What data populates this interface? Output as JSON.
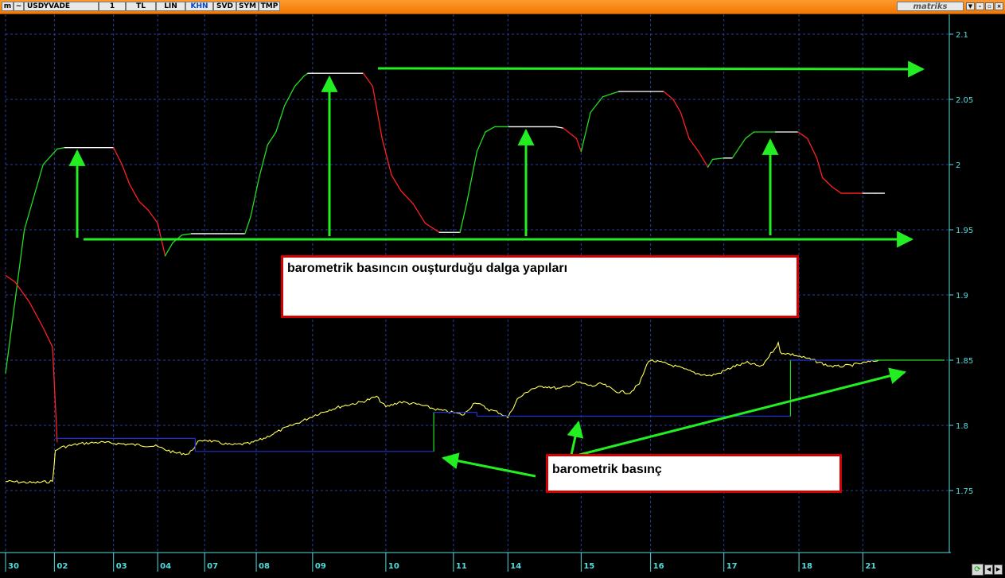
{
  "toolbar": {
    "symbol": "USDYVADE",
    "buttons": [
      {
        "label": "1",
        "active": false
      },
      {
        "label": "TL",
        "active": false
      },
      {
        "label": "LIN",
        "active": false
      },
      {
        "label": "KHN",
        "active": true
      },
      {
        "label": "SVD",
        "active": false
      },
      {
        "label": "SYM",
        "active": false
      },
      {
        "label": "TMP",
        "active": false
      }
    ],
    "brand": "matriks",
    "window_controls": [
      "▼",
      "–",
      "▫",
      "×"
    ]
  },
  "annotations": {
    "wave_text": "barometrik basıncın ouşturduğu dalga yapıları",
    "pressure_text": "barometrik basınç"
  },
  "chart_data": {
    "type": "line",
    "y_axis": {
      "min": 1.7,
      "max": 2.12,
      "ticks": [
        1.75,
        1.8,
        1.85,
        1.9,
        1.95,
        2.0,
        2.05,
        2.1
      ],
      "tick_labels": [
        "1.75",
        "1.8",
        "1.85",
        "1.9",
        "1.95",
        "2",
        "2.05",
        "2.1"
      ],
      "side": "right"
    },
    "x_axis": {
      "min": 0,
      "max": 100,
      "ticks": [
        0,
        5.2,
        11.5,
        16.2,
        21.2,
        26.7,
        32.7,
        40.5,
        47.7,
        53.5,
        61.3,
        68.7,
        76.5,
        84.5,
        91.3
      ],
      "tick_labels": [
        "30",
        "02",
        "03",
        "04",
        "07",
        "08",
        "09",
        "10",
        "11",
        "14",
        "15",
        "16",
        "17",
        "18",
        "21"
      ]
    },
    "grid": true,
    "colors": {
      "up": "#22dd22",
      "down": "#ff2020",
      "flat": "#ffffff",
      "price": "#ffff55",
      "step": "#2233cc",
      "step_rise": "#22dd22",
      "arrow": "#22ee22",
      "axis": "#55dddd"
    },
    "series": [
      {
        "role": "wave",
        "x": [
          0,
          2,
          4,
          5.5,
          6.3,
          8.3,
          11.5,
          12.4,
          13.2,
          14.2,
          15.2,
          16.2,
          17,
          17.8,
          18.8,
          19.8,
          21,
          23,
          25.5,
          26.1,
          27,
          27.9,
          28.8,
          29.7,
          30.8,
          31.8,
          32.2,
          32.7,
          33.8,
          38.1,
          39.1,
          40.1,
          41.1,
          42.1,
          43.4,
          44.7,
          46.2,
          48.4,
          49.1,
          50.2,
          51.1,
          52.1,
          53.6,
          58.6,
          59.4,
          60.8,
          61.3,
          62.3,
          63.6,
          65.3,
          68.7,
          70.1,
          71.1,
          71.9,
          72.8,
          73.8,
          74.8,
          75.3,
          76.5,
          77.4,
          78.8,
          79.7,
          82,
          84.4,
          85.4,
          86.4,
          87,
          88,
          89,
          90,
          91.3,
          92.7,
          93.6
        ],
        "values": [
          1.84,
          1.95,
          2.0,
          2.012,
          2.013,
          2.013,
          2.013,
          2.0,
          1.985,
          1.972,
          1.965,
          1.955,
          1.93,
          1.94,
          1.946,
          1.947,
          1.947,
          1.947,
          1.947,
          1.96,
          1.99,
          2.015,
          2.025,
          2.045,
          2.06,
          2.068,
          2.07,
          2.07,
          2.07,
          2.07,
          2.06,
          2.02,
          1.992,
          1.98,
          1.97,
          1.955,
          1.948,
          1.948,
          1.97,
          2.01,
          2.025,
          2.029,
          2.029,
          2.029,
          2.028,
          2.02,
          2.01,
          2.04,
          2.052,
          2.056,
          2.056,
          2.056,
          2.05,
          2.04,
          2.02,
          2.01,
          1.998,
          2.004,
          2.005,
          2.005,
          2.02,
          2.025,
          2.025,
          2.025,
          2.02,
          2.005,
          1.99,
          1.983,
          1.978,
          1.978,
          1.978,
          1.978,
          1.978
        ],
        "colors": [
          "up",
          "up",
          "up",
          "up",
          "flat",
          "flat",
          "down",
          "down",
          "down",
          "down",
          "down",
          "down",
          "up",
          "up",
          "up",
          "flat",
          "flat",
          "flat",
          "up",
          "up",
          "up",
          "up",
          "up",
          "up",
          "up",
          "up",
          "flat",
          "flat",
          "flat",
          "down",
          "down",
          "down",
          "down",
          "down",
          "down",
          "down",
          "flat",
          "up",
          "up",
          "up",
          "up",
          "up",
          "flat",
          "flat",
          "down",
          "down",
          "up",
          "up",
          "up",
          "flat",
          "flat",
          "down",
          "down",
          "down",
          "down",
          "down",
          "up",
          "up",
          "flat",
          "up",
          "up",
          "up",
          "flat",
          "down",
          "down",
          "down",
          "down",
          "down",
          "down",
          "down",
          "flat",
          "flat"
        ]
      },
      {
        "role": "early-decline",
        "x": [
          0,
          1,
          2.5,
          4,
          5,
          5.5
        ],
        "values": [
          1.915,
          1.91,
          1.895,
          1.875,
          1.86,
          1.787
        ]
      },
      {
        "role": "price",
        "x": [
          0,
          3,
          5,
          5.3,
          5.8,
          8,
          10,
          12,
          14,
          16,
          18,
          19.5,
          20.5,
          21.2,
          22.5,
          24,
          26,
          27.5,
          29.5,
          31.5,
          33,
          34.5,
          36,
          38,
          39.5,
          40.5,
          42,
          44,
          46,
          47.5,
          48.8,
          50,
          51.5,
          52.5,
          53.5,
          54.5,
          56,
          57.5,
          59,
          61,
          62.5,
          63.5,
          65,
          66.5,
          67.5,
          68.5,
          70,
          71.5,
          73.5,
          75,
          76,
          77.5,
          79,
          80.5,
          82.3,
          82.5,
          84,
          86,
          87.5,
          88.5,
          90,
          91.5,
          93
        ],
        "values": [
          1.757,
          1.756,
          1.757,
          1.78,
          1.783,
          1.786,
          1.787,
          1.786,
          1.785,
          1.784,
          1.779,
          1.778,
          1.787,
          1.789,
          1.787,
          1.785,
          1.786,
          1.79,
          1.797,
          1.803,
          1.808,
          1.812,
          1.815,
          1.818,
          1.822,
          1.814,
          1.818,
          1.816,
          1.812,
          1.81,
          1.808,
          1.818,
          1.812,
          1.81,
          1.806,
          1.82,
          1.828,
          1.83,
          1.828,
          1.833,
          1.83,
          1.832,
          1.826,
          1.825,
          1.832,
          1.85,
          1.848,
          1.845,
          1.84,
          1.838,
          1.84,
          1.845,
          1.848,
          1.845,
          1.863,
          1.856,
          1.854,
          1.85,
          1.846,
          1.845,
          1.846,
          1.848,
          1.85
        ]
      },
      {
        "role": "pressure-step",
        "x": [
          5.3,
          20.2,
          20.2,
          45.6,
          45.6,
          50.2,
          50.2,
          83.6,
          83.6,
          92.5,
          100
        ],
        "values": [
          1.79,
          1.79,
          1.78,
          1.78,
          1.81,
          1.81,
          1.807,
          1.807,
          1.85,
          1.85,
          1.85
        ]
      }
    ]
  }
}
